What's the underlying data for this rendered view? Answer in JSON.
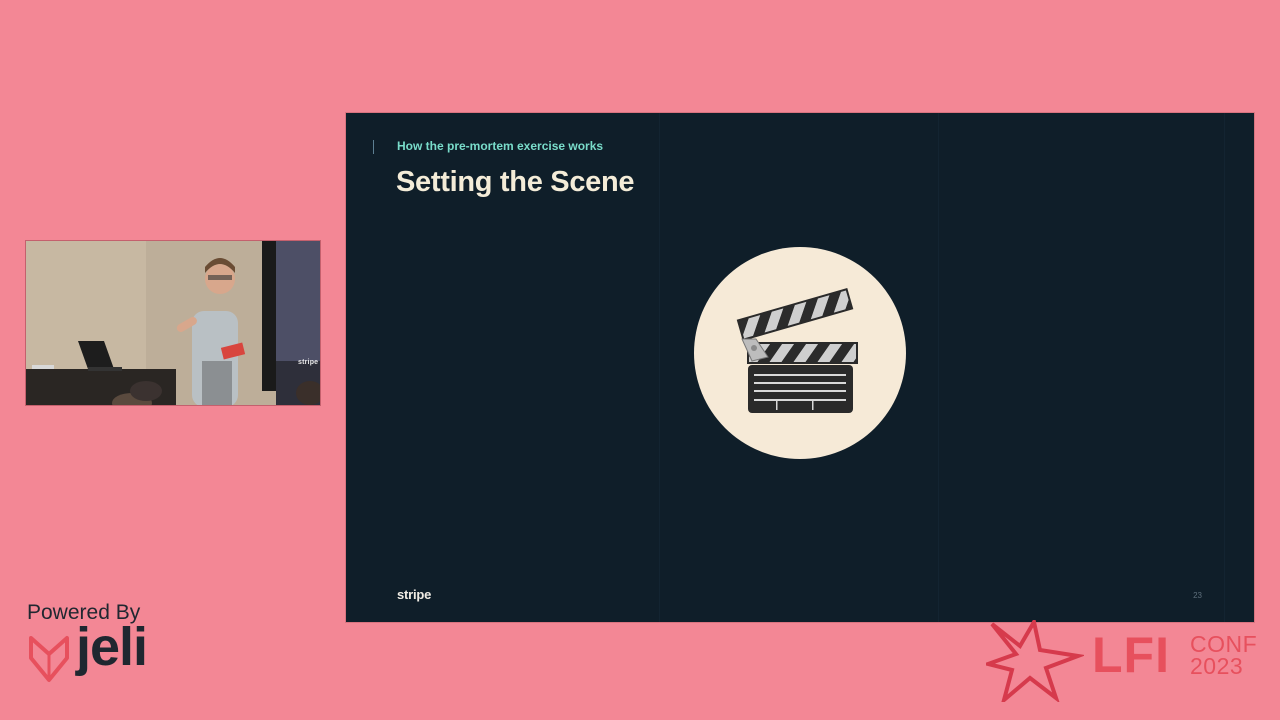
{
  "video": {
    "backdrop_logo": "stripe"
  },
  "slide": {
    "eyebrow": "How the pre-mortem exercise works",
    "title": "Setting the Scene",
    "illustration": "clapperboard-icon",
    "brand": "stripe",
    "page_number": "23"
  },
  "footer": {
    "powered_label": "Powered By",
    "powered_brand": "jeli",
    "conference_name": "LFI",
    "conference_word": "CONF",
    "conference_year": "2023"
  },
  "colors": {
    "page_background": "#f38795",
    "slide_background": "#0f1e29",
    "eyebrow": "#79dcca",
    "title": "#f4ecd8",
    "badge": "#f6ead7",
    "brand_dark": "#1f2730",
    "conference_red": "#e7505d"
  }
}
